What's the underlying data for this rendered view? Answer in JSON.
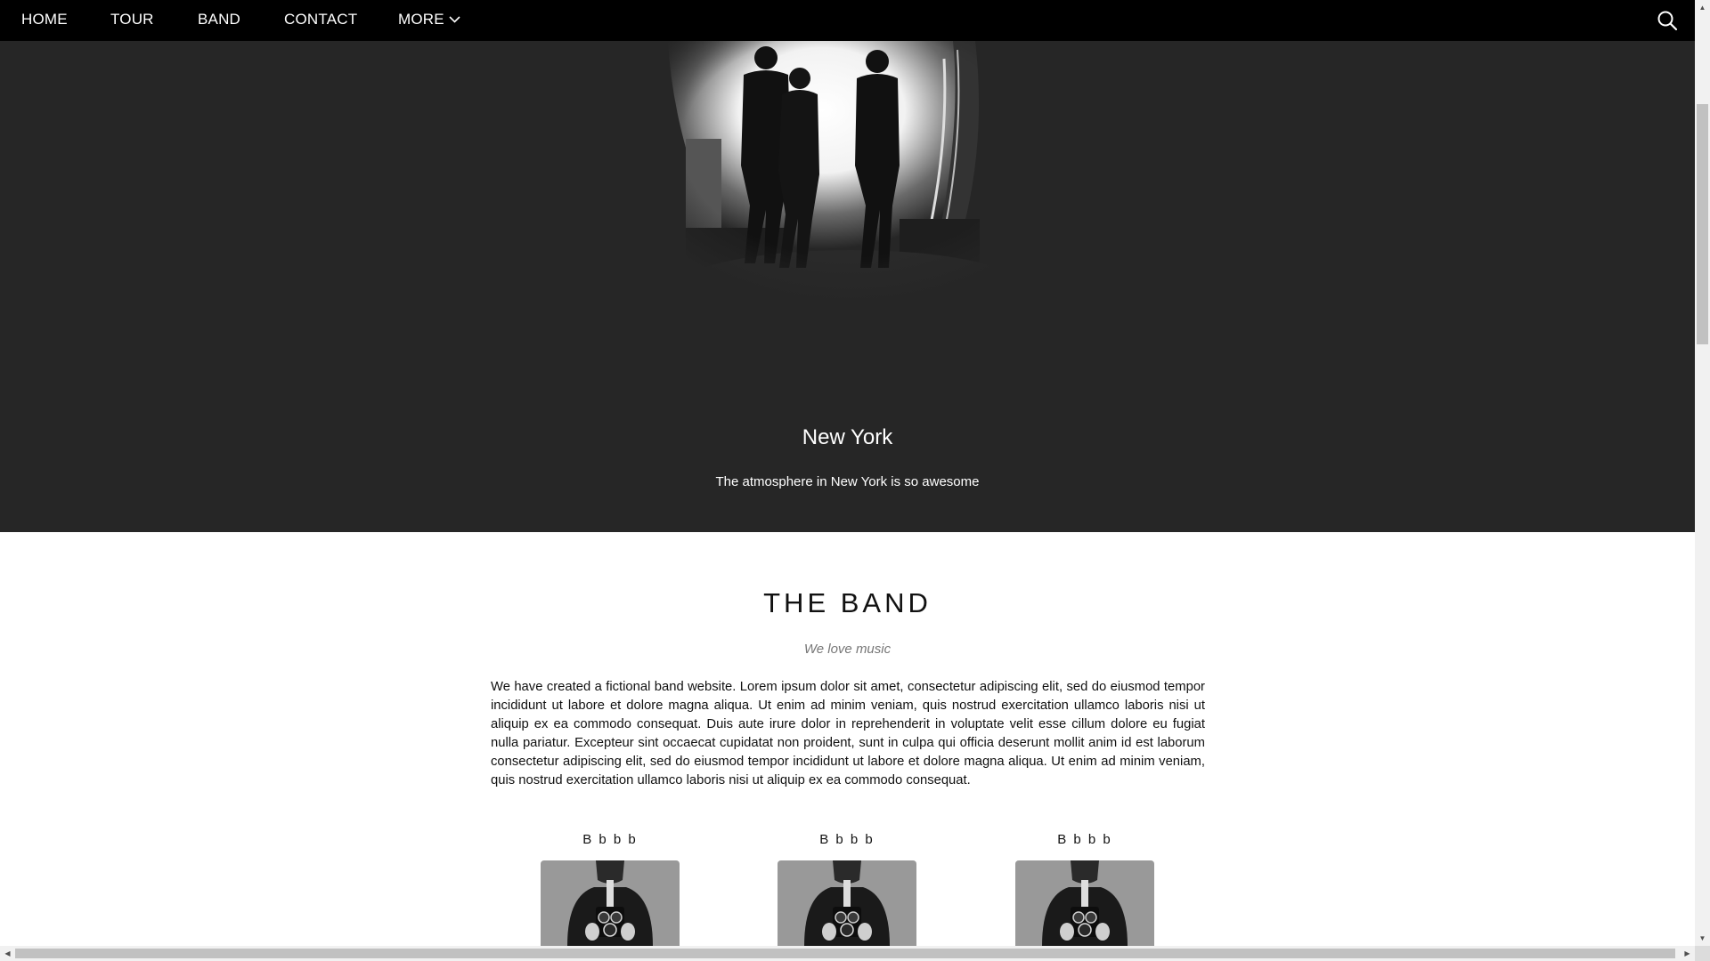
{
  "nav": {
    "items": [
      {
        "label": "HOME"
      },
      {
        "label": "TOUR"
      },
      {
        "label": "BAND"
      },
      {
        "label": "CONTACT"
      },
      {
        "label": "MORE"
      }
    ],
    "search_icon": "search-icon",
    "more_icon": "chevron-down-icon"
  },
  "hero": {
    "title": "New York",
    "caption": "The atmosphere in New York is so awesome",
    "photo": "black-and-white photo of three people walking toward bright doorway"
  },
  "band": {
    "title": "THE BAND",
    "tagline": "We love music",
    "body": "We have created a fictional band website. Lorem ipsum dolor sit amet, consectetur adipiscing elit, sed do eiusmod tempor incididunt ut labore et dolore magna aliqua. Ut enim ad minim veniam, quis nostrud exercitation ullamco laboris nisi ut aliquip ex ea commodo consequat. Duis aute irure dolor in reprehenderit in voluptate velit esse cillum dolore eu fugiat nulla pariatur. Excepteur sint occaecat cupidatat non proident, sunt in culpa qui officia deserunt mollit anim id est laborum consectetur adipiscing elit, sed do eiusmod tempor incididunt ut labore et dolore magna aliqua. Ut enim ad minim veniam, quis nostrud exercitation ullamco laboris nisi ut aliquip ex ea commodo consequat.",
    "members": [
      {
        "name": "B b b b"
      },
      {
        "name": "B b b b"
      },
      {
        "name": "B b b b"
      }
    ]
  },
  "colors": {
    "navbar": "#000000",
    "hero_bg": "#262626",
    "page_bg": "#ffffff",
    "tagline": "#777777"
  }
}
